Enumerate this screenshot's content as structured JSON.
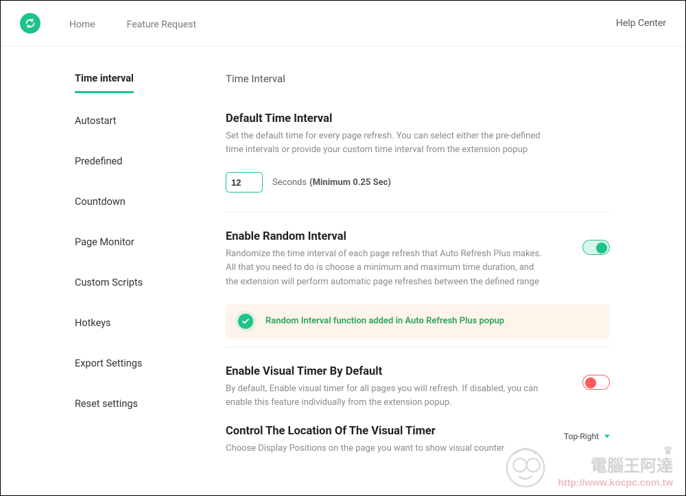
{
  "header": {
    "nav": {
      "home": "Home",
      "feature_request": "Feature Request"
    },
    "help_center": "Help Center"
  },
  "sidebar": {
    "items": [
      {
        "label": "Time interval",
        "active": true
      },
      {
        "label": "Autostart"
      },
      {
        "label": "Predefined"
      },
      {
        "label": "Countdown"
      },
      {
        "label": "Page Monitor"
      },
      {
        "label": "Custom Scripts"
      },
      {
        "label": "Hotkeys"
      },
      {
        "label": "Export Settings"
      },
      {
        "label": "Reset settings"
      }
    ]
  },
  "main": {
    "page_title": "Time Interval",
    "default_interval": {
      "title": "Default Time Interval",
      "desc": "Set the default time for every page refresh. You can select either the pre-defined time intervals or provide your custom time interval from the extension popup",
      "value": "12",
      "unit": "Seconds",
      "min_note": "(Minimum 0.25 Sec)"
    },
    "random_interval": {
      "title": "Enable Random Interval",
      "desc": "Randomize the time interval of each page refresh that Auto Refresh Plus makes. All that you need to do is choose a minimum and maximum time duration, and the extension will perform automatic page refreshes between the defined range",
      "enabled": true,
      "alert": "Random Interval function added in Auto Refresh Plus popup"
    },
    "visual_timer": {
      "title": "Enable Visual Timer By Default",
      "desc": "By default, Enable visual timer for all pages you will refresh. If disabled, you can enable this feature individually from the extension popup.",
      "enabled": false
    },
    "timer_location": {
      "title": "Control The Location Of The Visual Timer",
      "desc": "Choose Display Positions on the page you want to show visual counter",
      "value": "Top-Right"
    }
  },
  "watermark": {
    "text": "電腦王阿達",
    "url": "http://www.kocpc.com.tw"
  }
}
